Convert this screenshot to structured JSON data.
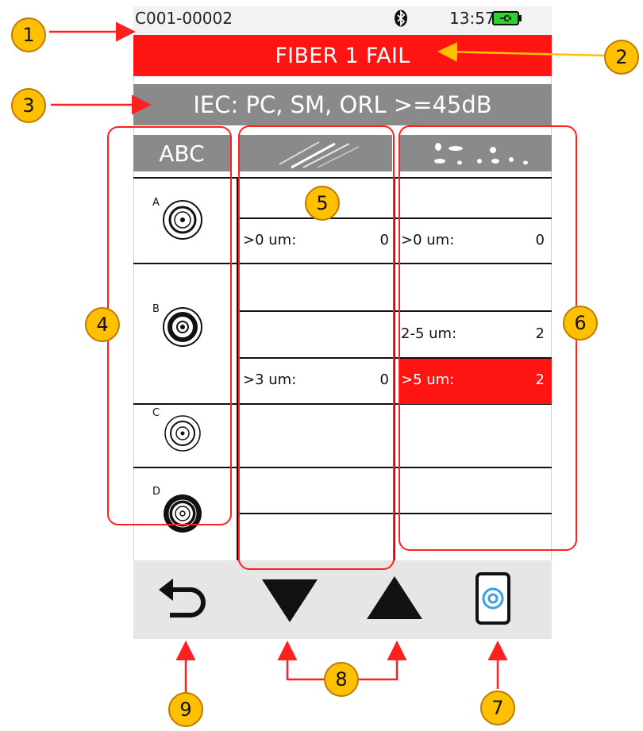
{
  "status": {
    "device_id": "C001-00002",
    "time": "13:57",
    "bluetooth_icon": "bluetooth-icon",
    "battery_icon": "battery-charging-icon"
  },
  "banner": {
    "result": "FIBER 1 FAIL",
    "color": "#ff1414"
  },
  "standard": {
    "label": "IEC: PC, SM, ORL >=45dB"
  },
  "columns": {
    "zone_header": "ABC",
    "scratch_header_icon": "scratches-icon",
    "defect_header_icon": "defects-icon"
  },
  "zones": [
    {
      "letter": "A"
    },
    {
      "letter": "B"
    },
    {
      "letter": "C"
    },
    {
      "letter": "D"
    }
  ],
  "scratches": [
    {
      "label": ">0 um:",
      "count": "0"
    },
    {
      "label": ">3 um:",
      "count": "0"
    }
  ],
  "defects": [
    {
      "label": ">0 um:",
      "count": "0"
    },
    {
      "label": "2-5 um:",
      "count": "2"
    },
    {
      "label": ">5 um:",
      "count": "2",
      "highlight": "#ff1414"
    }
  ],
  "toolbar": {
    "back_icon": "back-arrow-icon",
    "down_icon": "down-triangle-icon",
    "up_icon": "up-triangle-icon",
    "view_icon": "fiber-view-icon"
  },
  "callouts": {
    "c1": "1",
    "c2": "2",
    "c3": "3",
    "c4": "4",
    "c5": "5",
    "c6": "6",
    "c7": "7",
    "c8": "8",
    "c9": "9"
  }
}
